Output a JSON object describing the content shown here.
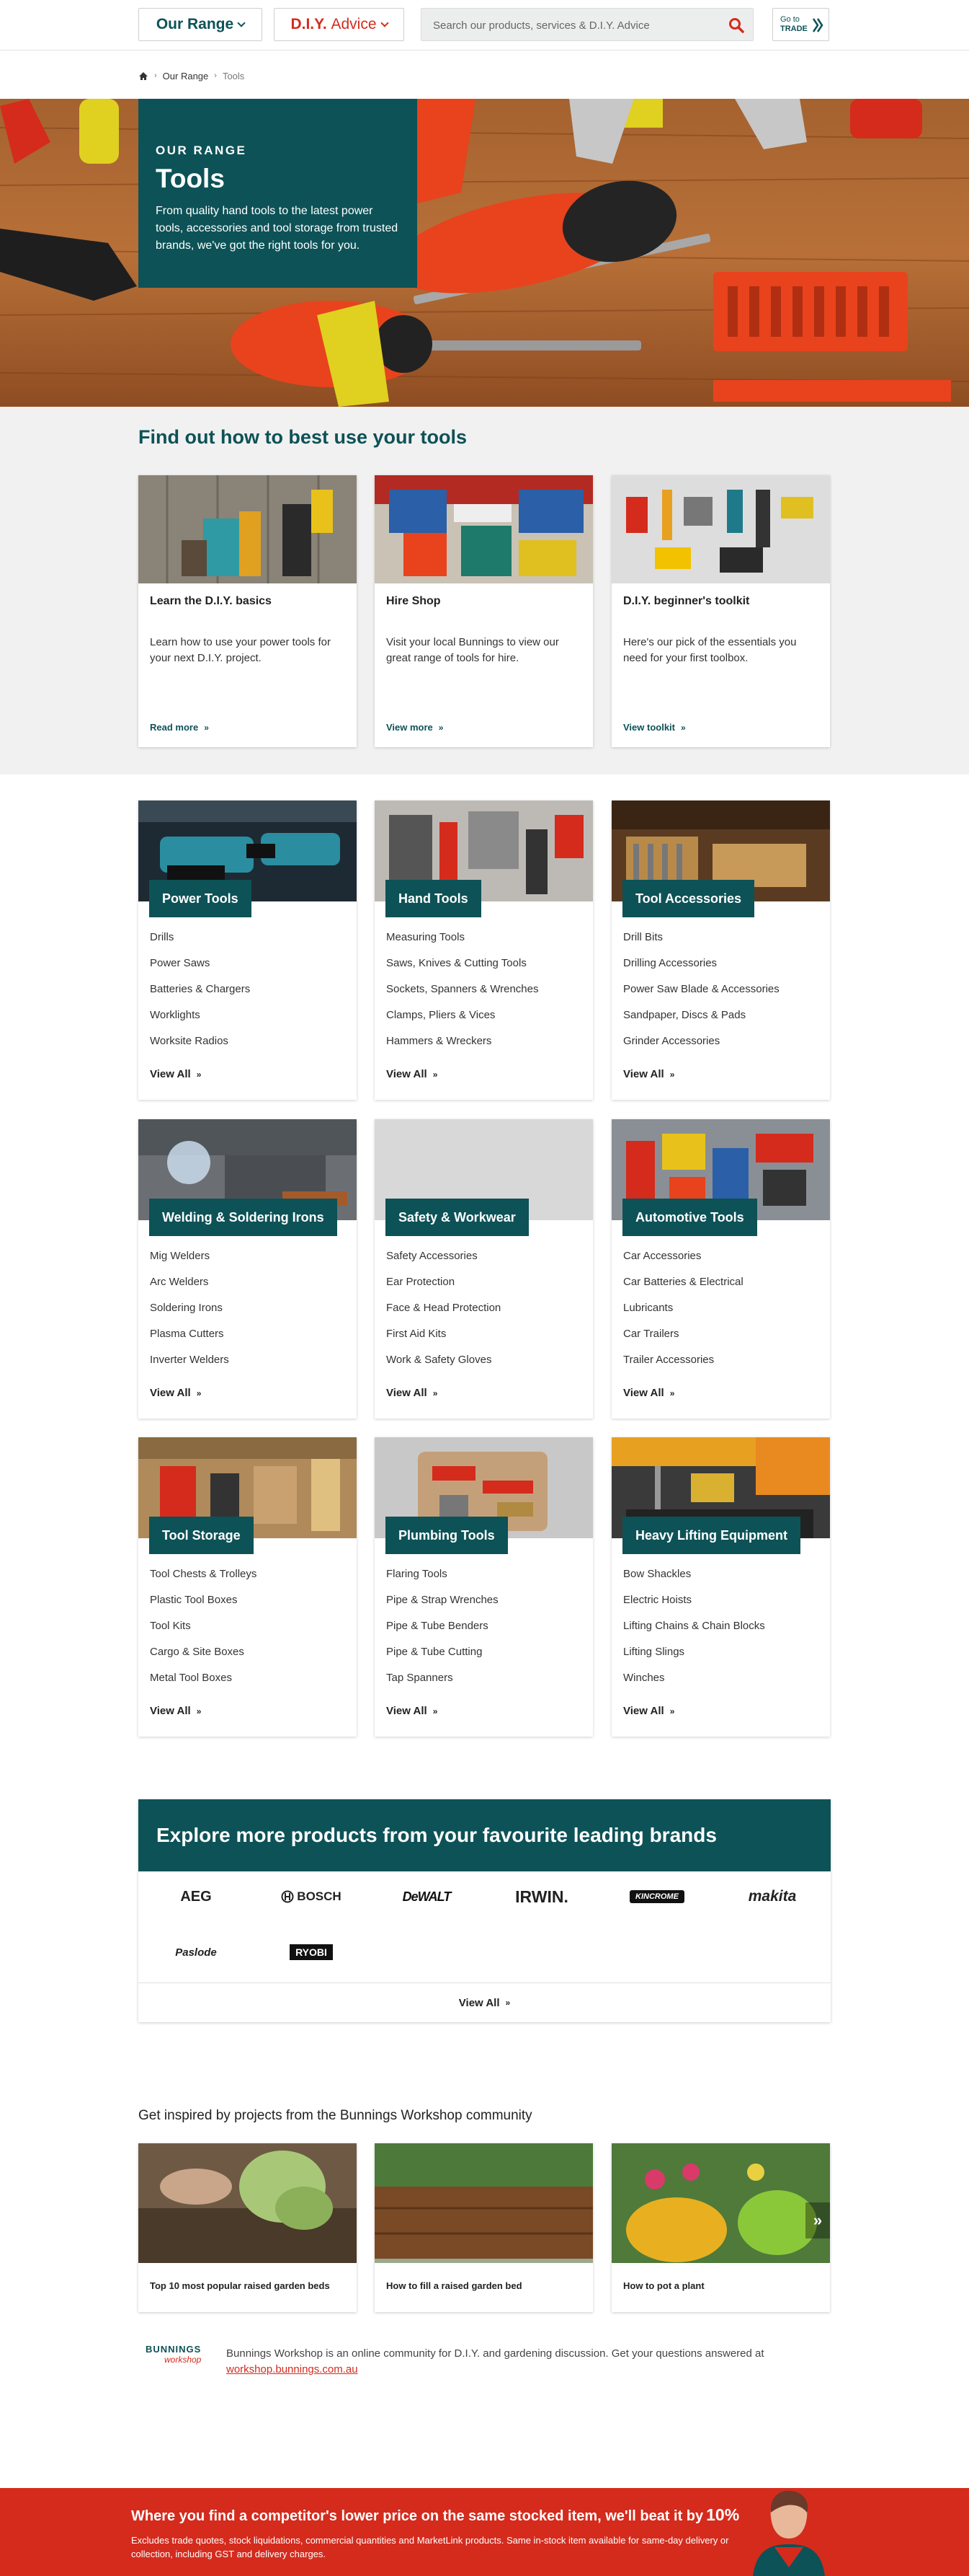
{
  "header": {
    "our_range_label": "Our Range",
    "diy_label_bold": "D.I.Y.",
    "diy_label_rest": "Advice",
    "search_placeholder": "Search our products, services & D.I.Y. Advice",
    "trade_line1": "Go to",
    "trade_line2": "TRADE"
  },
  "breadcrumb": {
    "home_icon": "home-icon",
    "items": [
      "Our Range",
      "Tools"
    ]
  },
  "hero": {
    "eyebrow": "OUR RANGE",
    "title": "Tools",
    "description": "From quality hand tools to the latest power tools, accessories and tool storage from trusted brands, we've got the right tools for you."
  },
  "learn": {
    "heading": "Find out how to best use your tools",
    "cards": [
      {
        "title": "Learn the D.I.Y. basics",
        "desc": "Learn how to use your power tools for your next D.I.Y. project.",
        "link": "Read more"
      },
      {
        "title": "Hire Shop",
        "desc": "Visit your local Bunnings to view our great range of tools for hire.",
        "link": "View more"
      },
      {
        "title": "D.I.Y. beginner's toolkit",
        "desc": "Here's our pick of the essentials you need for your first toolbox.",
        "link": "View toolkit"
      }
    ]
  },
  "categories": [
    {
      "name": "Power Tools",
      "items": [
        "Drills",
        "Power Saws",
        "Batteries & Chargers",
        "Worklights",
        "Worksite Radios"
      ],
      "link": "View All"
    },
    {
      "name": "Hand Tools",
      "items": [
        "Measuring Tools",
        "Saws, Knives & Cutting Tools",
        "Sockets, Spanners & Wrenches",
        "Clamps, Pliers & Vices",
        "Hammers & Wreckers"
      ],
      "link": "View All"
    },
    {
      "name": "Tool Accessories",
      "items": [
        "Drill Bits",
        "Drilling Accessories",
        "Power Saw Blade & Accessories",
        "Sandpaper, Discs & Pads",
        "Grinder Accessories"
      ],
      "link": "View All"
    },
    {
      "name": "Welding & Soldering Irons",
      "items": [
        "Mig Welders",
        "Arc Welders",
        "Soldering Irons",
        "Plasma Cutters",
        "Inverter Welders"
      ],
      "link": "View All"
    },
    {
      "name": "Safety & Workwear",
      "items": [
        "Safety Accessories",
        "Ear Protection",
        "Face & Head Protection",
        "First Aid Kits",
        "Work & Safety Gloves"
      ],
      "link": "View All"
    },
    {
      "name": "Automotive Tools",
      "items": [
        "Car Accessories",
        "Car Batteries & Electrical",
        "Lubricants",
        "Car Trailers",
        "Trailer Accessories"
      ],
      "link": "View All"
    },
    {
      "name": "Tool Storage",
      "items": [
        "Tool Chests & Trolleys",
        "Plastic Tool Boxes",
        "Tool Kits",
        "Cargo & Site Boxes",
        "Metal Tool Boxes"
      ],
      "link": "View All"
    },
    {
      "name": "Plumbing Tools",
      "items": [
        "Flaring Tools",
        "Pipe & Strap Wrenches",
        "Pipe & Tube Benders",
        "Pipe & Tube Cutting",
        "Tap Spanners"
      ],
      "link": "View All"
    },
    {
      "name": "Heavy Lifting Equipment",
      "items": [
        "Bow Shackles",
        "Electric Hoists",
        "Lifting Chains & Chain Blocks",
        "Lifting Slings",
        "Winches"
      ],
      "link": "View All"
    }
  ],
  "brands": {
    "heading": "Explore more products from your favourite leading brands",
    "logos": [
      "AEG",
      "BOSCH",
      "DeWALT",
      "IRWIN.",
      "KINCROME",
      "makita",
      "Paslode",
      "RYOBI"
    ],
    "link": "View All"
  },
  "workshop": {
    "heading": "Get inspired by projects from the Bunnings Workshop community",
    "cards": [
      {
        "title": "Top 10 most popular raised garden beds"
      },
      {
        "title": "How to fill a raised garden bed"
      },
      {
        "title": "How to pot a plant"
      }
    ],
    "logo_line1": "BUNNINGS",
    "logo_line2": "workshop",
    "info_text": "Bunnings Workshop is an online community for D.I.Y. and gardening discussion. Get your questions answered at",
    "info_link": "workshop.bunnings.com.au"
  },
  "promo": {
    "headline": "Where you find a competitor's lower price on the same stocked item, we'll beat it by",
    "headline_pct": "10%",
    "detail": "Excludes trade quotes, stock liquidations, commercial quantities and MarketLink products. Same in-stock item available for same-day delivery or collection, including GST and delivery charges."
  },
  "colors": {
    "brand_green": "#0d5257",
    "brand_red": "#d42b1d"
  }
}
